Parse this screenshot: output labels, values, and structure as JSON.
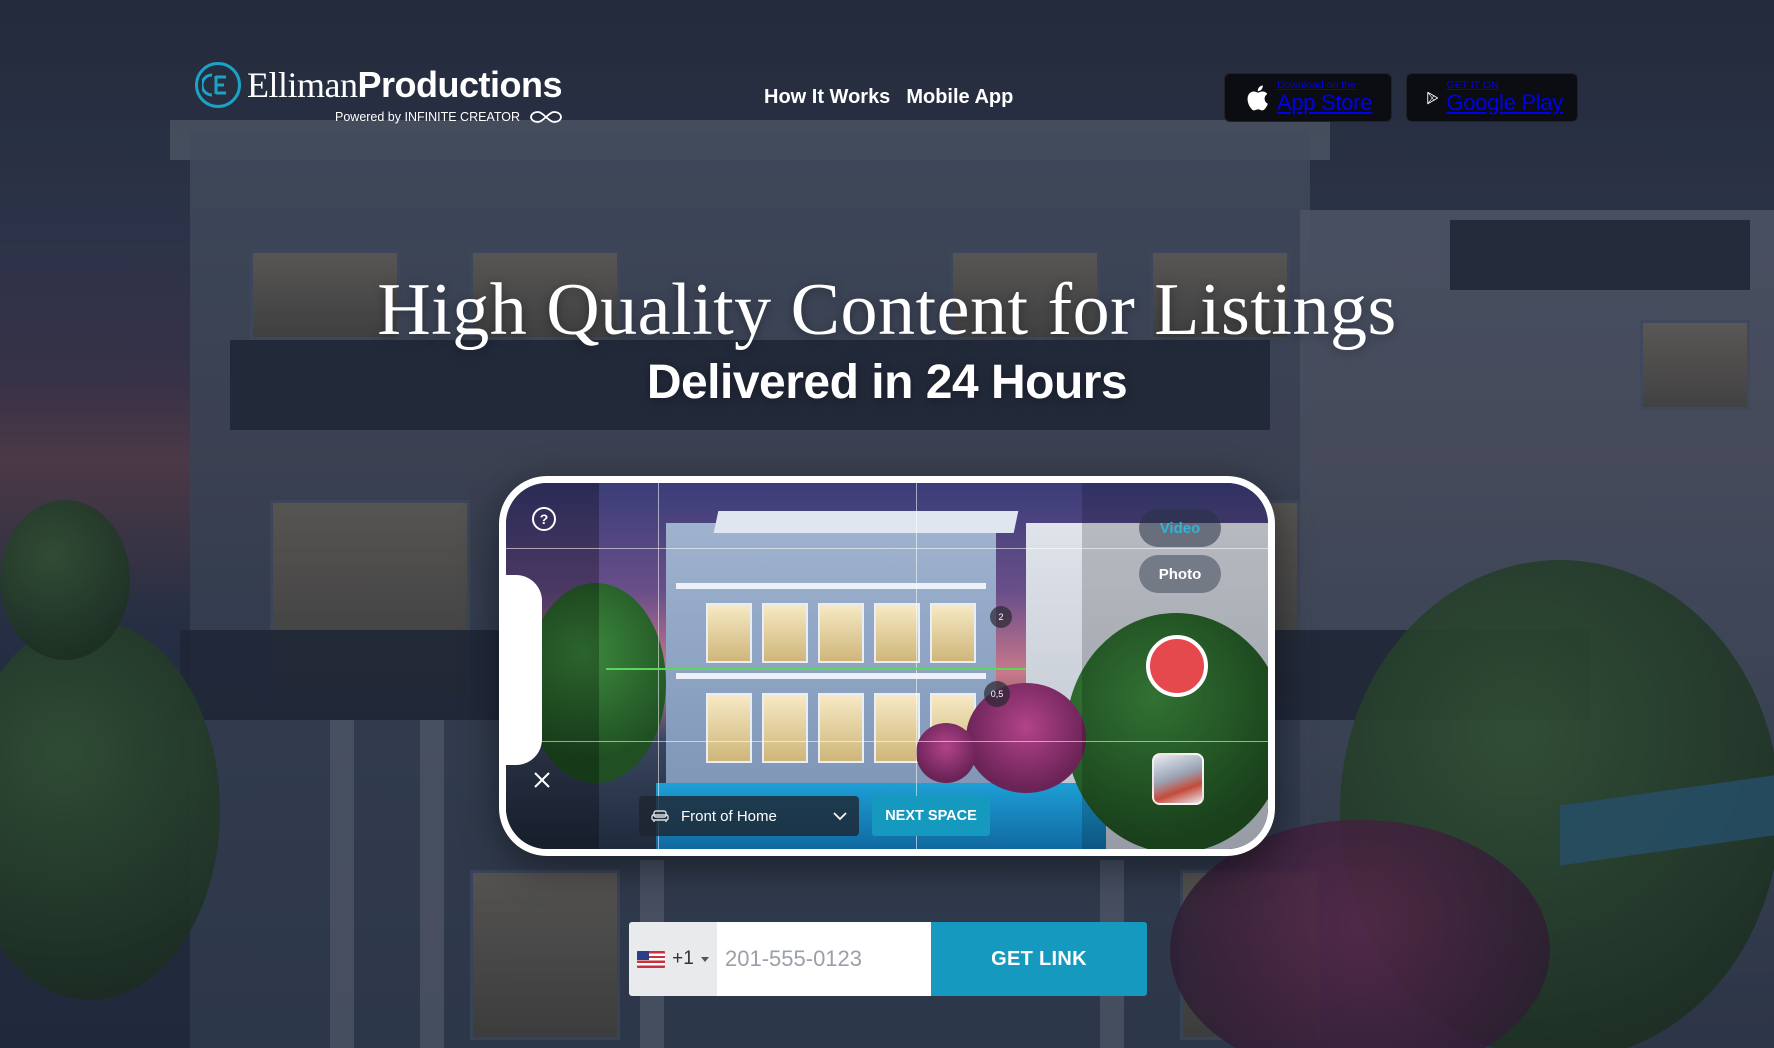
{
  "brand": {
    "name_thin": "Elliman",
    "name_bold": "Productions",
    "powered_by": "Powered by INFINITE CREATOR",
    "accent": "#1ba3c6"
  },
  "nav": {
    "items": [
      {
        "label": "How It Works"
      },
      {
        "label": "Mobile App"
      }
    ]
  },
  "stores": {
    "app_store": {
      "small": "Download on the",
      "big": "App Store",
      "icon": "apple-icon"
    },
    "google_play": {
      "small": "GET IT ON",
      "big": "Google Play",
      "icon": "google-play-icon"
    }
  },
  "hero": {
    "title": "High Quality Content for Listings",
    "subtitle": "Delivered in 24 Hours"
  },
  "camera_ui": {
    "modes": [
      "Video",
      "Photo"
    ],
    "selected_mode": "Video",
    "zoom_levels": [
      "2",
      "0,5"
    ],
    "space_select": "Front of Home",
    "next_space_label": "NEXT SPACE",
    "record_color": "#e5484d",
    "help_icon": "?"
  },
  "form": {
    "country_code": "+1",
    "phone_placeholder": "201-555-0123",
    "submit_label": "GET LINK",
    "button_color": "#1599bf"
  }
}
